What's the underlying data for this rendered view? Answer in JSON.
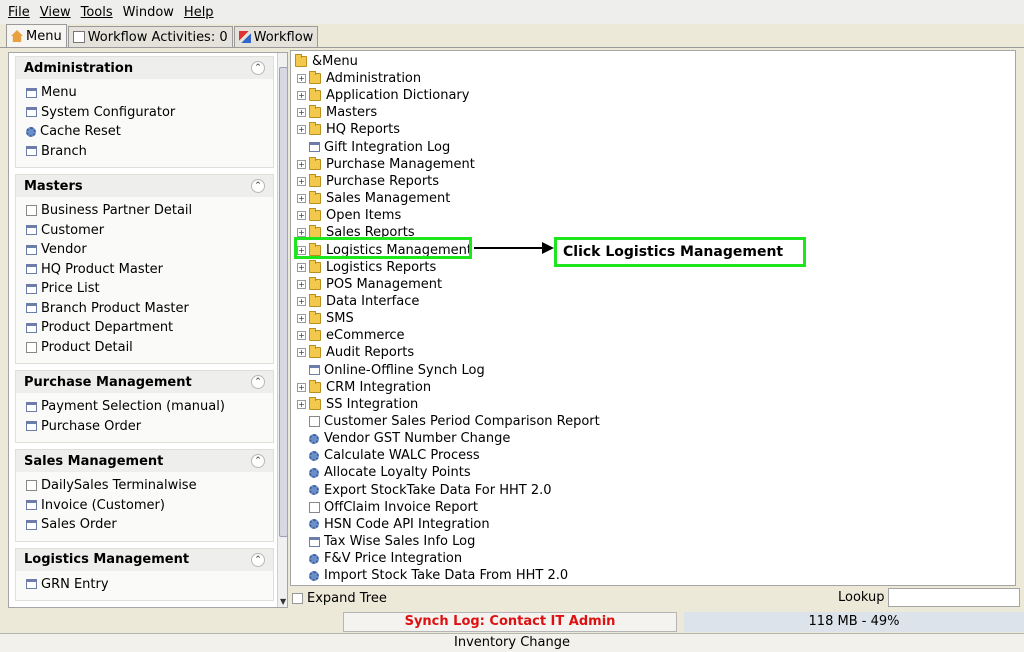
{
  "menubar": [
    {
      "label": "File"
    },
    {
      "label": "View"
    },
    {
      "label": "Tools"
    },
    {
      "label": "Window"
    },
    {
      "label": "Help"
    }
  ],
  "tabs": [
    {
      "label": "Menu",
      "icon": "home-icon"
    },
    {
      "label": "Workflow Activities: 0",
      "icon": "list-icon"
    },
    {
      "label": "Workflow",
      "icon": "workflow-icon"
    }
  ],
  "sidebar": {
    "groups": [
      {
        "title": "Administration",
        "items": [
          {
            "label": "Menu",
            "icon": "window-icon"
          },
          {
            "label": "System Configurator",
            "icon": "window-icon"
          },
          {
            "label": "Cache Reset",
            "icon": "process-icon"
          },
          {
            "label": "Branch",
            "icon": "window-icon"
          }
        ]
      },
      {
        "title": "Masters",
        "items": [
          {
            "label": "Business Partner Detail",
            "icon": "report-icon"
          },
          {
            "label": "Customer",
            "icon": "window-icon"
          },
          {
            "label": "Vendor",
            "icon": "window-icon"
          },
          {
            "label": "HQ Product Master",
            "icon": "window-icon"
          },
          {
            "label": "Price List",
            "icon": "window-icon"
          },
          {
            "label": "Branch Product Master",
            "icon": "window-icon"
          },
          {
            "label": "Product Department",
            "icon": "window-icon"
          },
          {
            "label": "Product Detail",
            "icon": "report-icon"
          }
        ]
      },
      {
        "title": "Purchase Management",
        "items": [
          {
            "label": "Payment Selection (manual)",
            "icon": "window-icon"
          },
          {
            "label": "Purchase Order",
            "icon": "window-icon"
          }
        ]
      },
      {
        "title": "Sales Management",
        "items": [
          {
            "label": "DailySales Terminalwise",
            "icon": "report-icon"
          },
          {
            "label": "Invoice (Customer)",
            "icon": "window-icon"
          },
          {
            "label": "Sales Order",
            "icon": "window-icon"
          }
        ]
      },
      {
        "title": "Logistics Management",
        "items": [
          {
            "label": "GRN Entry",
            "icon": "window-icon"
          }
        ]
      }
    ]
  },
  "tree": {
    "root": "&Menu",
    "items": [
      {
        "label": "Administration",
        "type": "folder"
      },
      {
        "label": "Application Dictionary",
        "type": "folder"
      },
      {
        "label": "Masters",
        "type": "folder"
      },
      {
        "label": "HQ Reports",
        "type": "folder"
      },
      {
        "label": "Gift Integration Log",
        "type": "window"
      },
      {
        "label": "Purchase Management",
        "type": "folder"
      },
      {
        "label": "Purchase Reports",
        "type": "folder"
      },
      {
        "label": "Sales Management",
        "type": "folder"
      },
      {
        "label": "Open Items",
        "type": "folder"
      },
      {
        "label": "Sales Reports",
        "type": "folder"
      },
      {
        "label": "Logistics Management",
        "type": "folder"
      },
      {
        "label": "Logistics Reports",
        "type": "folder"
      },
      {
        "label": "POS Management",
        "type": "folder"
      },
      {
        "label": "Data Interface",
        "type": "folder"
      },
      {
        "label": "SMS",
        "type": "folder"
      },
      {
        "label": "eCommerce",
        "type": "folder"
      },
      {
        "label": "Audit Reports",
        "type": "folder"
      },
      {
        "label": "Online-Offline Synch Log",
        "type": "window"
      },
      {
        "label": "CRM Integration",
        "type": "folder"
      },
      {
        "label": "SS Integration",
        "type": "folder"
      },
      {
        "label": "Customer Sales Period Comparison Report",
        "type": "report"
      },
      {
        "label": "Vendor GST Number Change",
        "type": "process"
      },
      {
        "label": "Calculate WALC Process",
        "type": "process"
      },
      {
        "label": "Allocate Loyalty Points",
        "type": "process"
      },
      {
        "label": "Export StockTake Data For HHT 2.0",
        "type": "process"
      },
      {
        "label": "OffClaim Invoice Report",
        "type": "report"
      },
      {
        "label": "HSN Code API Integration",
        "type": "process"
      },
      {
        "label": "Tax Wise Sales Info Log",
        "type": "window"
      },
      {
        "label": "F&V Price Integration",
        "type": "process"
      },
      {
        "label": "Import Stock Take Data From HHT 2.0",
        "type": "process"
      }
    ]
  },
  "annotation": {
    "callout": "Click Logistics Management"
  },
  "bottom": {
    "expand_tree": "Expand Tree",
    "lookup": "Lookup",
    "lookup_value": ""
  },
  "status": {
    "synch": "Synch Log: Contact IT Admin",
    "memory": "118 MB - 49%",
    "footer": "Inventory Change"
  },
  "colors": {
    "highlight": "#1ee51e",
    "synch_text": "#dd1111"
  }
}
